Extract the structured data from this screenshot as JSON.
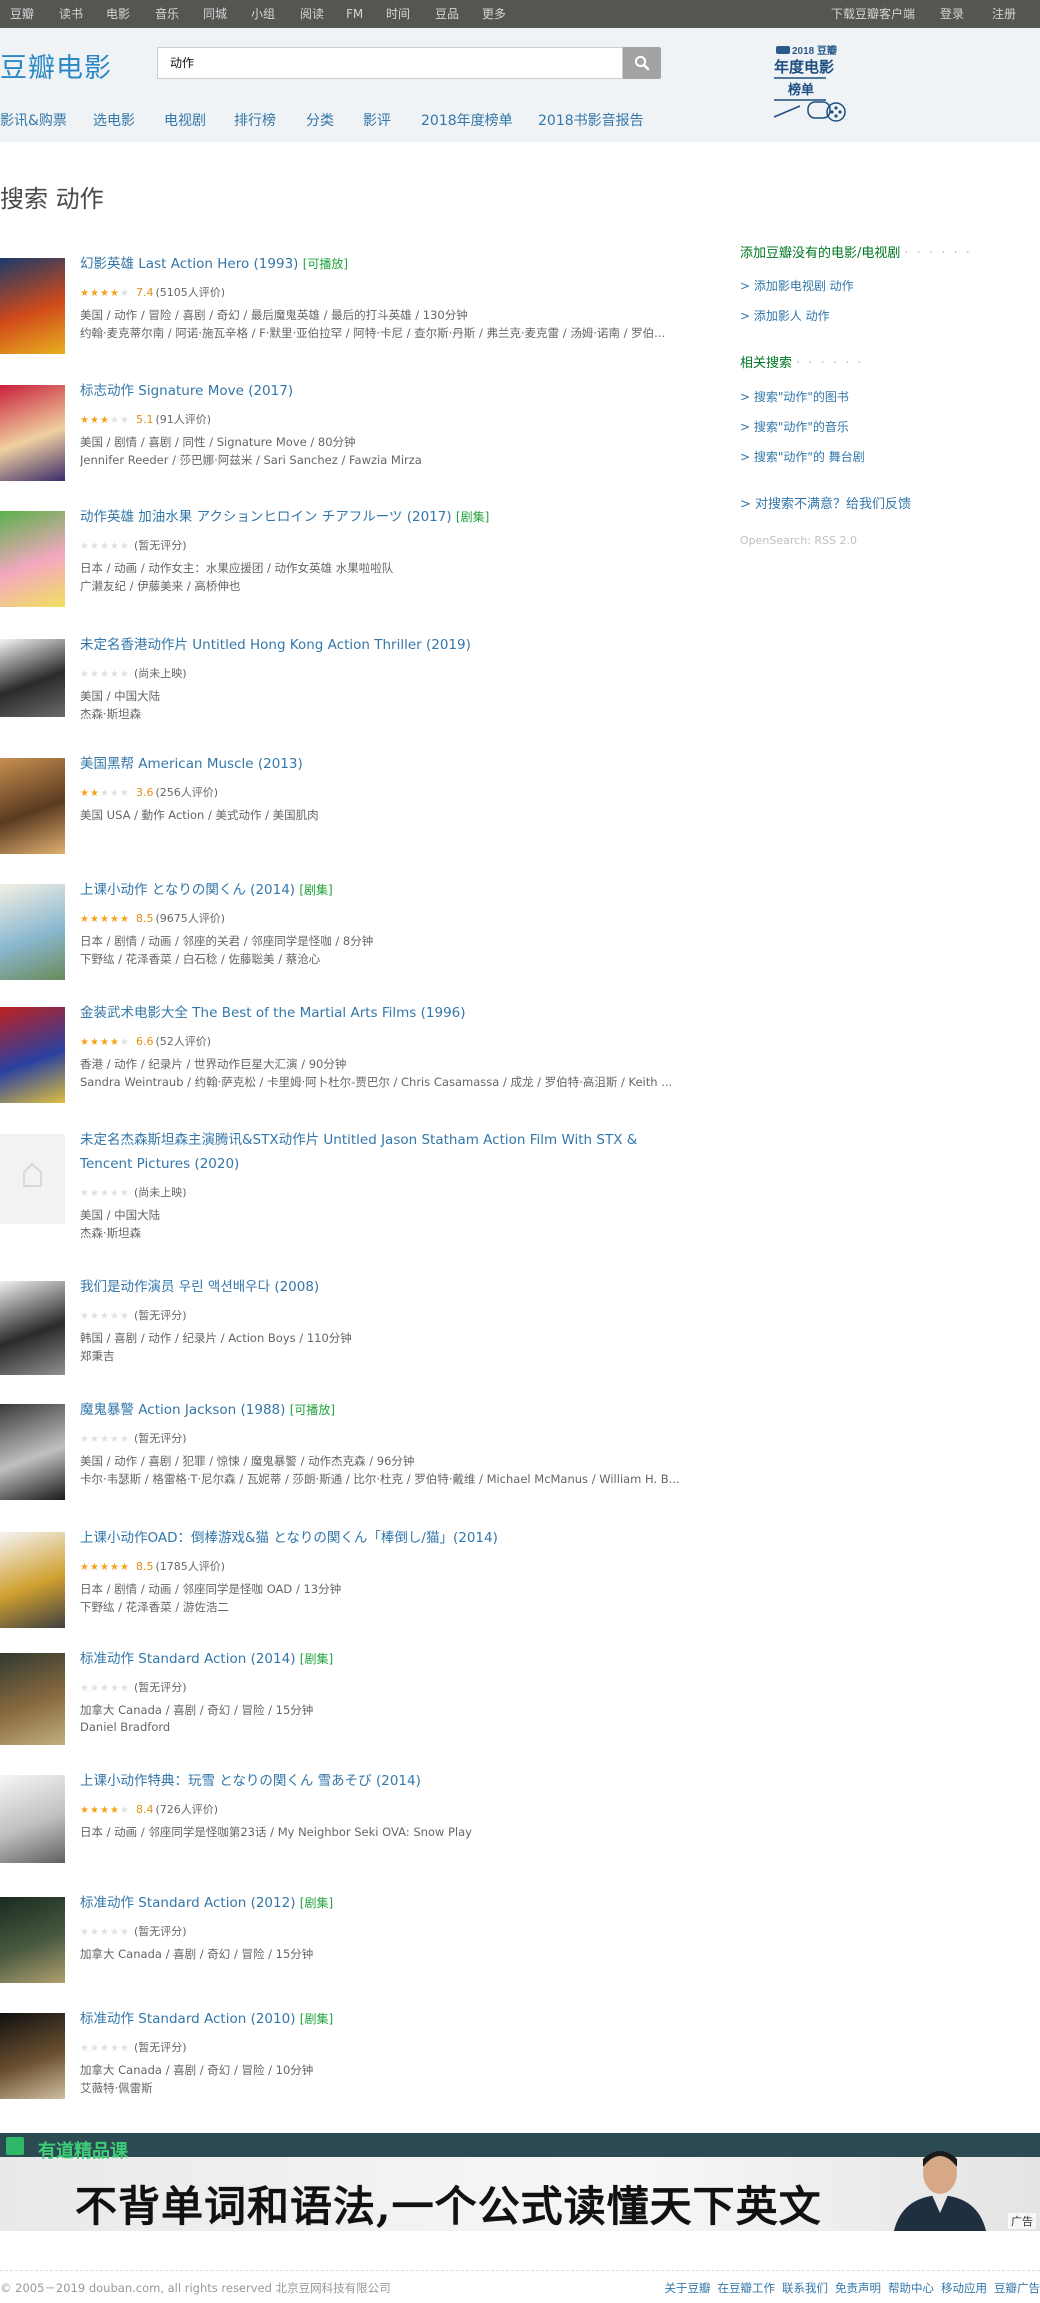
{
  "global_nav": {
    "left": [
      "豆瓣",
      "读书",
      "电影",
      "音乐",
      "同城",
      "小组",
      "阅读",
      "FM",
      "时间",
      "豆品",
      "更多"
    ],
    "right": [
      "下载豆瓣客户端",
      "登录",
      "注册"
    ]
  },
  "header": {
    "logo": "豆瓣电影",
    "search_value": "动作",
    "badge_line1": "2018 豆瓣",
    "badge_line2": "年度电影",
    "badge_line3": "榜单",
    "sub_nav": [
      "影讯&购票",
      "选电影",
      "电视剧",
      "排行榜",
      "分类",
      "影评",
      "2018年度榜单",
      "2018书影音报告"
    ]
  },
  "page_title": "搜索 动作",
  "results": [
    {
      "title": "幻影英雄 Last Action Hero (1993)",
      "tag": "[可播放]",
      "rating": "7.4",
      "count": "(5105人评价)",
      "stars": 3.5,
      "meta1": "美国 / 动作 / 冒险 / 喜剧 / 奇幻 / 最后魔鬼英雄 / 最后的打斗英雄 / 130分钟",
      "meta2": "约翰·麦克蒂尔南 / 阿诺·施瓦辛格 / F·默里·亚伯拉罕 / 阿特·卡尼 / 查尔斯·丹斯 / 弗兰克·麦克雷 / 汤姆·诺南 / 罗伯...",
      "colors": [
        "#1a3a6a",
        "#d04a1a",
        "#e8b020"
      ]
    },
    {
      "title": "标志动作 Signature Move (2017)",
      "tag": "",
      "rating": "5.1",
      "count": "(91人评价)",
      "stars": 2.5,
      "meta1": "美国 / 剧情 / 喜剧 / 同性 / Signature Move / 80分钟",
      "meta2": "Jennifer Reeder / 莎巴娜·阿兹米 / Sari Sanchez / Fawzia Mirza",
      "colors": [
        "#c8203a",
        "#f0d0a0",
        "#3a2a6a"
      ]
    },
    {
      "title": "动作英雄 加油水果 アクションヒロイン チアフルーツ (2017)",
      "tag": "[剧集]",
      "rating": "",
      "count": "(暂无评分)",
      "stars": 0,
      "meta1": "日本 / 动画 / 动作女主：水果应援团 / 动作女英雄 水果啦啦队",
      "meta2": "广濑友纪 / 伊藤美来 / 高桥伸也",
      "colors": [
        "#5ab04a",
        "#f4a8c0",
        "#f0e060"
      ]
    },
    {
      "title": "未定名香港动作片 Untitled Hong Kong Action Thriller (2019)",
      "tag": "",
      "rating": "",
      "count": "(尚未上映)",
      "stars": 0,
      "meta1": "美国 / 中国大陆",
      "meta2": "杰森·斯坦森",
      "colors": [
        "#f4f4f4",
        "#2a2a2a",
        "#6a6a6a"
      ]
    },
    {
      "title": "美国黑帮 American Muscle (2013)",
      "tag": "",
      "rating": "3.6",
      "count": "(256人评价)",
      "stars": 1.5,
      "meta1": "美国 USA / 動作 Action / 美式动作 / 美国肌肉",
      "meta2": "",
      "colors": [
        "#c89050",
        "#5a3a20",
        "#e0b070"
      ]
    },
    {
      "title": "上课小动作 となりの関くん (2014)",
      "tag": "[剧集]",
      "rating": "8.5",
      "count": "(9675人评价)",
      "stars": 4.5,
      "meta1": "日本 / 剧情 / 动画 / 邻座的关君 / 邻座同学是怪咖 / 8分钟",
      "meta2": "下野纮 / 花泽香菜 / 白石稔 / 佐藤聡美 / 蔡沧心",
      "colors": [
        "#f4f0e4",
        "#8ab8d0",
        "#6a8a5a"
      ]
    },
    {
      "title": "金装武术电影大全 The Best of the Martial Arts Films (1996)",
      "tag": "",
      "rating": "6.6",
      "count": "(52人评价)",
      "stars": 3.5,
      "meta1": "香港 / 动作 / 纪录片 / 世界动作巨星大汇演 / 90分钟",
      "meta2": "Sandra Weintraub / 约翰·萨克松 / 卡里姆·阿卜杜尔-贾巴尔 / Chris Casamassa / 成龙 / 罗伯特·高沮斯 / Keith ...",
      "colors": [
        "#c02020",
        "#2a40a0",
        "#e0c040"
      ]
    },
    {
      "title": "未定名杰森斯坦森主演腾讯&STX动作片 Untitled Jason Statham Action Film With STX & Tencent Pictures (2020)",
      "tag": "",
      "rating": "",
      "count": "(尚未上映)",
      "stars": 0,
      "meta1": "美国 / 中国大陆",
      "meta2": "杰森·斯坦森",
      "colors": [
        "#f2f2f2",
        "#e0e0e0",
        "#d0d0d0"
      ]
    },
    {
      "title": "我们是动作演员 우린 액션배우다 (2008)",
      "tag": "",
      "rating": "",
      "count": "(暂无评分)",
      "stars": 0,
      "meta1": "韩国 / 喜剧 / 动作 / 纪录片 / Action Boys / 110分钟",
      "meta2": "郑秉吉",
      "colors": [
        "#f0f0f0",
        "#2a2a2a",
        "#909090"
      ]
    },
    {
      "title": "魔鬼暴警 Action Jackson (1988)",
      "tag": "[可播放]",
      "rating": "",
      "count": "(暂无评分)",
      "stars": 0,
      "meta1": "美国 / 动作 / 喜剧 / 犯罪 / 惊悚 / 魔鬼暴警 / 动作杰克森 / 96分钟",
      "meta2": "卡尔·韦瑟斯 / 格雷格·T·尼尔森 / 瓦妮蒂 / 莎朗·斯通 / 比尔·杜克 / 罗伯特·戴维 / Michael McManus / William H. B...",
      "colors": [
        "#3a3a3a",
        "#c0c0c0",
        "#1a1a1a"
      ]
    },
    {
      "title": "上课小动作OAD：倒棒游戏&猫 となりの関くん「棒倒し/猫」(2014)",
      "tag": "",
      "rating": "8.5",
      "count": "(1785人评价)",
      "stars": 4.5,
      "meta1": "日本 / 剧情 / 动画 / 邻座同学是怪咖 OAD / 13分钟",
      "meta2": "下野纮 / 花泽香菜 / 游佐浩二",
      "colors": [
        "#f4f4f4",
        "#d0a030",
        "#404040"
      ]
    },
    {
      "title": "标准动作 Standard Action (2014)",
      "tag": "[剧集]",
      "rating": "",
      "count": "(暂无评分)",
      "stars": 0,
      "meta1": "加拿大 Canada / 喜剧 / 奇幻 / 冒险 / 15分钟",
      "meta2": "Daniel Bradford",
      "colors": [
        "#303a30",
        "#8a6a40",
        "#c0b080"
      ]
    },
    {
      "title": "上课小动作特典：玩雪 となりの関くん 雪あそび (2014)",
      "tag": "",
      "rating": "8.4",
      "count": "(726人评价)",
      "stars": 4,
      "meta1": "日本 / 动画 / 邻座同学是怪咖第23话 / My Neighbor Seki OVA: Snow Play",
      "meta2": "",
      "colors": [
        "#f6f6f6",
        "#c0c0c0",
        "#606060"
      ]
    },
    {
      "title": "标准动作 Standard Action (2012)",
      "tag": "[剧集]",
      "rating": "",
      "count": "(暂无评分)",
      "stars": 0,
      "meta1": "加拿大 Canada / 喜剧 / 奇幻 / 冒险 / 15分钟",
      "meta2": "",
      "colors": [
        "#1a2a20",
        "#4a5a40",
        "#b0a070"
      ]
    },
    {
      "title": "标准动作 Standard Action (2010)",
      "tag": "[剧集]",
      "rating": "",
      "count": "(暂无评分)",
      "stars": 0,
      "meta1": "加拿大 Canada / 喜剧 / 奇幻 / 冒险 / 10分钟",
      "meta2": "艾薇特·佩雷斯",
      "colors": [
        "#101010",
        "#6a5030",
        "#d0c0a0"
      ]
    }
  ],
  "aside": {
    "add_heading": "添加豆瓣没有的电影/电视剧",
    "add_links": [
      "> 添加影电视剧 动作",
      "> 添加影人 动作"
    ],
    "related_heading": "相关搜索",
    "related_links": [
      "> 搜索\"动作\"的图书",
      "> 搜索\"动作\"的音乐",
      "> 搜索\"动作\"的 舞台剧"
    ],
    "feedback": "> 对搜索不满意？给我们反馈",
    "opensearch": "OpenSearch: RSS 2.0"
  },
  "ad": {
    "brand": "有道精品课",
    "slogan": "不背单词和语法,一个公式读懂天下英文",
    "label": "广告"
  },
  "footer": {
    "copyright": "© 2005－2019 douban.com, all rights reserved 北京豆网科技有限公司",
    "links": [
      "关于豆瓣",
      "在豆瓣工作",
      "联系我们",
      "免责声明",
      "帮助中心",
      "移动应用",
      "豆瓣广告"
    ]
  }
}
